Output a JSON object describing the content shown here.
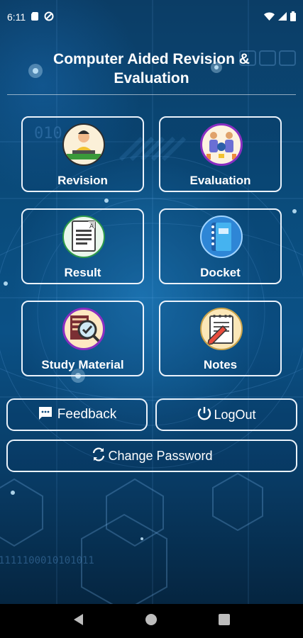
{
  "status_bar": {
    "time": "6:11"
  },
  "header": {
    "title_line1": "Computer Aided Revision &",
    "title_line2": "Evaluation"
  },
  "tiles": [
    {
      "label": "Revision"
    },
    {
      "label": "Evaluation"
    },
    {
      "label": "Result"
    },
    {
      "label": "Docket"
    },
    {
      "label": "Study Material"
    },
    {
      "label": "Notes"
    }
  ],
  "buttons": {
    "feedback": "Feedback",
    "logout": "LogOut",
    "change_password": "Change Password"
  },
  "background_text": {
    "binary_top": "010",
    "binary_bottom": "1111100010101011"
  },
  "colors": {
    "accent": "#eaf2fb",
    "background": "#0b4a7c"
  }
}
